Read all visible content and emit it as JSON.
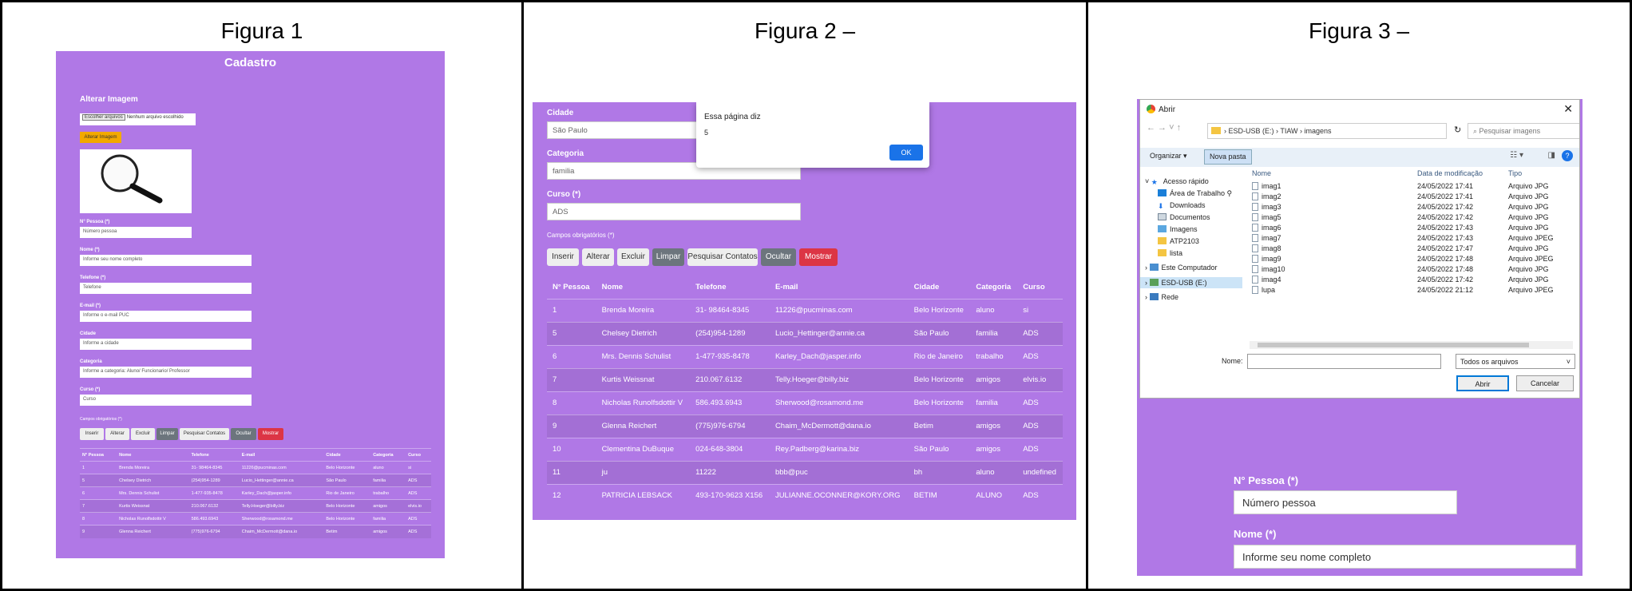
{
  "panels": {
    "p1": "Figura 1",
    "p2": "Figura 2 –",
    "p3": "Figura 3 –"
  },
  "fig1": {
    "title": "Cadastro",
    "alter_heading": "Alterar Imagem",
    "file_button": "Escolher arquivos",
    "file_status": "Nenhum arquivo escolhido",
    "alter_button": "Alterar Imagem",
    "fields": [
      {
        "label": "N° Pessoa (*)",
        "placeholder": "Número pessoa"
      },
      {
        "label": "Nome (*)",
        "placeholder": "Informe seu nome completo"
      },
      {
        "label": "Telefone (*)",
        "placeholder": "Telefone"
      },
      {
        "label": "E-mail (*)",
        "placeholder": "Informe o e-mail PUC"
      },
      {
        "label": "Cidade",
        "placeholder": "Informe a cidade"
      },
      {
        "label": "Categoria",
        "placeholder": "Informe a categoria: Aluno/ Funcionario/ Professor"
      },
      {
        "label": "Curso (*)",
        "placeholder": "Curso"
      }
    ],
    "required_note": "Campos obrigatórios (*)",
    "buttons": [
      "Inserir",
      "Alterar",
      "Excluir",
      "Limpar",
      "Pesquisar Contatos",
      "Ocultar",
      "Mostrar"
    ],
    "columns": [
      "N° Pessoa",
      "Nome",
      "Telefone",
      "E-mail",
      "Cidade",
      "Categoria",
      "Curso"
    ],
    "rows": [
      [
        "1",
        "Brenda Moreira",
        "31- 98464-8345",
        "11226@pucminas.com",
        "Belo Horizonte",
        "aluno",
        "si"
      ],
      [
        "5",
        "Chelsey Dietrich",
        "(254)954-1289",
        "Lucio_Hettinger@annie.ca",
        "São Paulo",
        "familia",
        "ADS"
      ],
      [
        "6",
        "Mrs. Dennis Schulist",
        "1-477-935-8478",
        "Karley_Dach@jasper.info",
        "Rio de Janeiro",
        "trabalho",
        "ADS"
      ],
      [
        "7",
        "Kurtis Weissnat",
        "210.067.6132",
        "Telly.Hoeger@billy.biz",
        "Belo Horizonte",
        "amigos",
        "elvis.io"
      ],
      [
        "8",
        "Nicholas Runolfsdottir V",
        "586.493.6943",
        "Sherwood@rosamond.me",
        "Belo Horizonte",
        "familia",
        "ADS"
      ],
      [
        "9",
        "Glenna Reichert",
        "(775)976-6794",
        "Chaim_McDermott@dana.io",
        "Betim",
        "amigos",
        "ADS"
      ]
    ]
  },
  "fig2": {
    "fields": [
      {
        "label": "Cidade",
        "value": "São Paulo"
      },
      {
        "label": "Categoria",
        "value": "familia"
      },
      {
        "label": "Curso (*)",
        "value": "ADS"
      }
    ],
    "required_note": "Campos obrigatórios (*)",
    "buttons": [
      "Inserir",
      "Alterar",
      "Excluir",
      "Limpar",
      "Pesquisar Contatos",
      "Ocultar",
      "Mostrar"
    ],
    "columns": [
      "N° Pessoa",
      "Nome",
      "Telefone",
      "E-mail",
      "Cidade",
      "Categoria",
      "Curso"
    ],
    "rows": [
      [
        "1",
        "Brenda Moreira",
        "31- 98464-8345",
        "11226@pucminas.com",
        "Belo Horizonte",
        "aluno",
        "si"
      ],
      [
        "5",
        "Chelsey Dietrich",
        "(254)954-1289",
        "Lucio_Hettinger@annie.ca",
        "São Paulo",
        "familia",
        "ADS"
      ],
      [
        "6",
        "Mrs. Dennis Schulist",
        "1-477-935-8478",
        "Karley_Dach@jasper.info",
        "Rio de Janeiro",
        "trabalho",
        "ADS"
      ],
      [
        "7",
        "Kurtis Weissnat",
        "210.067.6132",
        "Telly.Hoeger@billy.biz",
        "Belo Horizonte",
        "amigos",
        "elvis.io"
      ],
      [
        "8",
        "Nicholas Runolfsdottir V",
        "586.493.6943",
        "Sherwood@rosamond.me",
        "Belo Horizonte",
        "familia",
        "ADS"
      ],
      [
        "9",
        "Glenna Reichert",
        "(775)976-6794",
        "Chaim_McDermott@dana.io",
        "Betim",
        "amigos",
        "ADS"
      ],
      [
        "10",
        "Clementina DuBuque",
        "024-648-3804",
        "Rey.Padberg@karina.biz",
        "São Paulo",
        "amigos",
        "ADS"
      ],
      [
        "11",
        "ju",
        "11222",
        "bbb@puc",
        "bh",
        "aluno",
        "undefined"
      ],
      [
        "12",
        "PATRICIA LEBSACK",
        "493-170-9623 X156",
        "JULIANNE.OCONNER@KORY.ORG",
        "BETIM",
        "ALUNO",
        "ADS"
      ]
    ],
    "dialog": {
      "title": "Essa página diz",
      "message": "5",
      "ok": "OK"
    }
  },
  "fig3": {
    "fields": [
      {
        "label": "N° Pessoa (*)",
        "value": "Número pessoa"
      },
      {
        "label": "Nome (*)",
        "value": "Informe seu nome completo"
      }
    ],
    "dialog": {
      "title": "Abrir",
      "path": [
        "ESD-USB (E:)",
        "TIAW",
        "imagens"
      ],
      "search_placeholder": "Pesquisar imagens",
      "organize": "Organizar ▾",
      "new_folder": "Nova pasta",
      "nav": [
        "Acesso rápido",
        "Área de Trabalho",
        "Downloads",
        "Documentos",
        "Imagens",
        "ATP2103",
        "lista",
        "Este Computador",
        "ESD-USB (E:)",
        "Rede"
      ],
      "columns": [
        "Nome",
        "Data de modificação",
        "Tipo"
      ],
      "files": [
        [
          "imag1",
          "24/05/2022 17:41",
          "Arquivo JPG"
        ],
        [
          "imag2",
          "24/05/2022 17:41",
          "Arquivo JPG"
        ],
        [
          "imag3",
          "24/05/2022 17:42",
          "Arquivo JPG"
        ],
        [
          "imag5",
          "24/05/2022 17:42",
          "Arquivo JPG"
        ],
        [
          "imag6",
          "24/05/2022 17:43",
          "Arquivo JPG"
        ],
        [
          "imag7",
          "24/05/2022 17:43",
          "Arquivo JPEG"
        ],
        [
          "imag8",
          "24/05/2022 17:47",
          "Arquivo JPG"
        ],
        [
          "imag9",
          "24/05/2022 17:48",
          "Arquivo JPEG"
        ],
        [
          "imag10",
          "24/05/2022 17:48",
          "Arquivo JPG"
        ],
        [
          "imag4",
          "24/05/2022 17:42",
          "Arquivo JPG"
        ],
        [
          "lupa",
          "24/05/2022 21:12",
          "Arquivo JPEG"
        ]
      ],
      "name_label": "Nome:",
      "filter": "Todos os arquivos",
      "open": "Abrir",
      "cancel": "Cancelar"
    }
  },
  "colors": {
    "accent": "#b078e6",
    "danger": "#dc3545",
    "warning": "#f2a900",
    "primary": "#1a73e8"
  }
}
